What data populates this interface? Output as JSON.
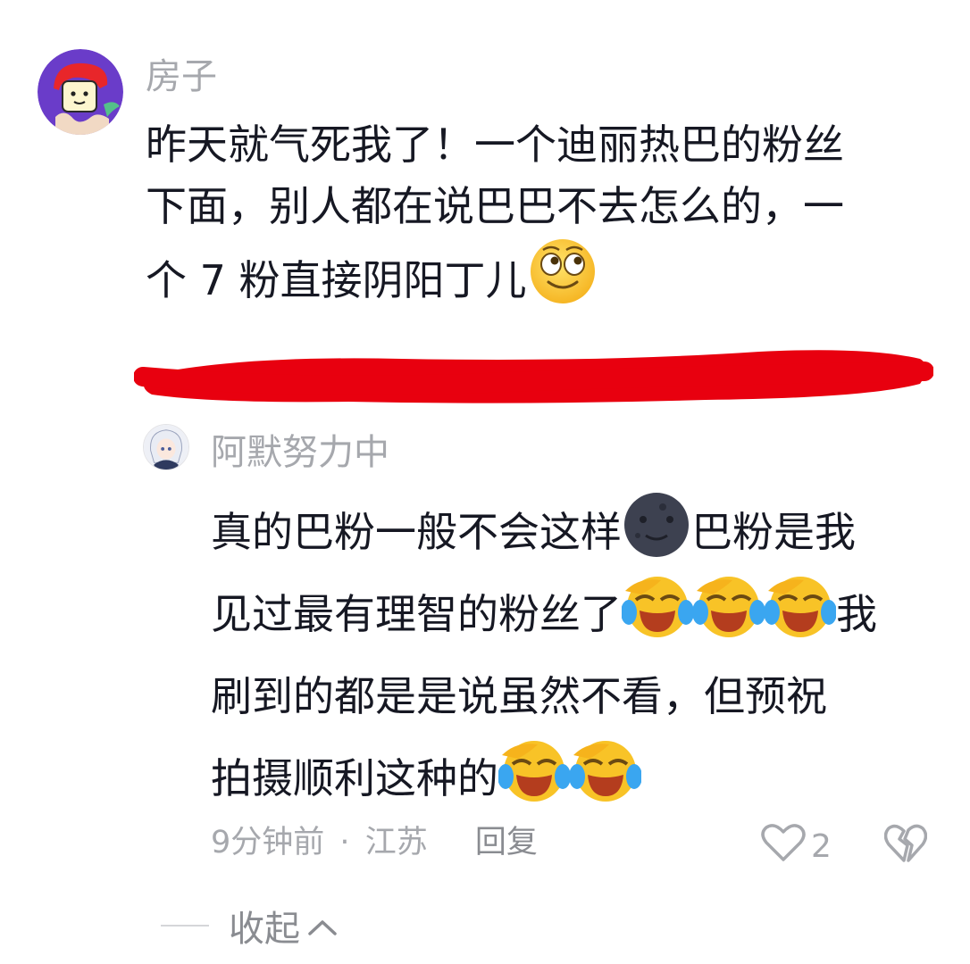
{
  "comment": {
    "username": "房子",
    "text_lines": [
      "昨天就气死我了！一个迪丽热巴的粉丝",
      "下面，别人都在说巴巴不去怎么的，一",
      "个 7 粉直接阴阳丁儿"
    ],
    "text_emoji": "smile-rolling-eyes-emoji"
  },
  "reply": {
    "username": "阿默努力中",
    "line1_a": "真的巴粉一般不会这样",
    "line1_b": "巴粉是我",
    "line2_a": "见过最有理智的粉丝了",
    "line2_b": "我",
    "line3": "刷到的都是是说虽然不看，但预祝",
    "line4": "拍摄顺利这种的",
    "emojis": [
      "new-moon-face-emoji",
      "laughing-crying-emoji"
    ],
    "time": "9分钟前",
    "separator": "·",
    "location": "江苏",
    "reply_label": "回复",
    "like_count": "2"
  },
  "collapse_label": "收起",
  "colors": {
    "text": "#161823",
    "meta": "#a6a8ad",
    "redaction": "#e8000f"
  }
}
